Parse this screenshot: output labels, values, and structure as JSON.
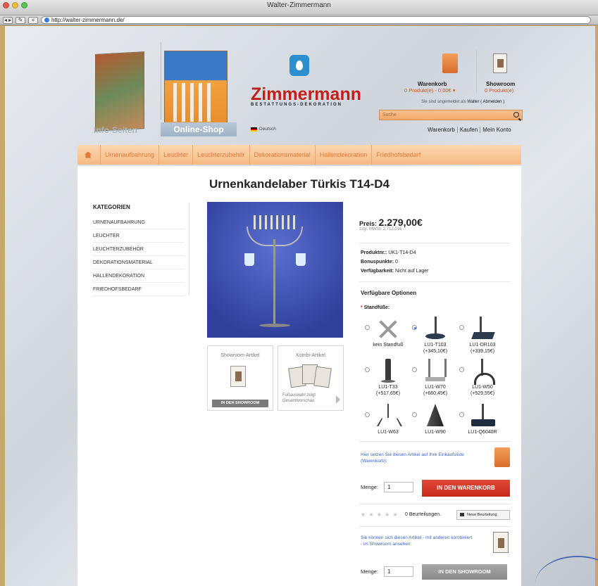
{
  "window": {
    "title": "Walter-Zimmermann"
  },
  "browser": {
    "url": "http://walter-zimmermann.de/",
    "back_label": "◂ ▸",
    "add_label": "+"
  },
  "header": {
    "logo_text": "Zimmermann",
    "logo_sub": "BESTATTUNGS-DEKORATION",
    "cart_title": "Warenkorb",
    "cart_value": "0 Produkt(e) - 0,00€ ▾",
    "showroom_title": "Showroom",
    "showroom_value": "0 Produkt(e)",
    "login_prefix": "Sie sind angemeldet als",
    "login_user": "Walter ( Abmelden )",
    "search_placeholder": "Suche",
    "account_links": [
      "Warenkorb",
      "Kaufen",
      "Mein Konto"
    ],
    "tab_info": "Info-Seiten",
    "tab_shop": "Online-Shop",
    "language": "Deutsch"
  },
  "nav": {
    "items": [
      "Urnenaufbahrung",
      "Leuchter",
      "Leuchterzubehör",
      "Dekorationsmaterial",
      "Hallendekoration",
      "Friedhofsbedarf"
    ]
  },
  "product": {
    "title": "Urnenkandelaber Türkis T14-D4",
    "price_label": "Preis:",
    "price_value": "2.279,00€",
    "price_sub": "zzgl. MWSt: 2.712,01€",
    "meta": [
      {
        "label": "Produktnr.:",
        "value": "UK1-T14-D4"
      },
      {
        "label": "Bonuspunkte:",
        "value": "0"
      },
      {
        "label": "Verfügbarkeit:",
        "value": "Nicht auf Lager"
      }
    ],
    "options_head": "Verfügbare Optionen",
    "stand_label": "Standfüße:",
    "stand_required_mark": "*",
    "options": [
      {
        "name": "kein Standfuß",
        "price": "",
        "icon": "no-stand-icon",
        "selected": false
      },
      {
        "name": "LU1-T103",
        "price": "(+345,10€)",
        "icon": "pole-stand-icon",
        "selected": true
      },
      {
        "name": "LU1-DR103",
        "price": "(+339,15€)",
        "icon": "square-stand-icon",
        "selected": false
      },
      {
        "name": "LU1-T33",
        "price": "(+517,65€)",
        "icon": "tube-stand-icon",
        "selected": false
      },
      {
        "name": "LU1-W70",
        "price": "(+660,45€)",
        "icon": "w-stand-icon",
        "selected": false
      },
      {
        "name": "LU1-W50",
        "price": "(+529,55€)",
        "icon": "arc-stand-icon",
        "selected": false
      },
      {
        "name": "LU1-W63",
        "price": "",
        "icon": "tripod-stand-icon",
        "selected": false
      },
      {
        "name": "LU1-W90",
        "price": "",
        "icon": "pyramid-stand-icon",
        "selected": false
      },
      {
        "name": "LU1-Q6040R",
        "price": "",
        "icon": "disc-stand-icon",
        "selected": false
      }
    ],
    "cart_hint": "Hier setzen Sie diesen Artikel auf Ihre Einkaufsliste (Warenkorb):",
    "qty_label": "Menge:",
    "qty_value": "1",
    "add_to_cart": "IN DEN WARENKORB",
    "reviews_stars": "★ ★ ★ ★ ★",
    "reviews_count": "0 Beurteilungen.",
    "new_review": "Neue Beurteilung",
    "showroom_hint": "Sie können sich diesen Artikel - mit anderen kombiniert - im Showroom ansehen:",
    "qty2_label": "Menge:",
    "qty2_value": "1",
    "add_to_showroom": "IN DEN SHOWROOM"
  },
  "categories": {
    "title": "KATEGORIEN",
    "items": [
      "URNENAUFBAHRUNG",
      "LEUCHTER",
      "LEUCHTERZUBEHÖR",
      "DEKORATIONSMATERIAL",
      "HALLENDEKORATION",
      "FRIEDHOFSBEDARF"
    ]
  },
  "thumbs": {
    "showroom_title": "Showroom-Artikel",
    "showroom_btn": "IN DEN SHOWROOM",
    "kombi_title": "Kombi-Artikel",
    "kombi_note": "Fußauswahl zeigt Gesamtvorschau"
  }
}
